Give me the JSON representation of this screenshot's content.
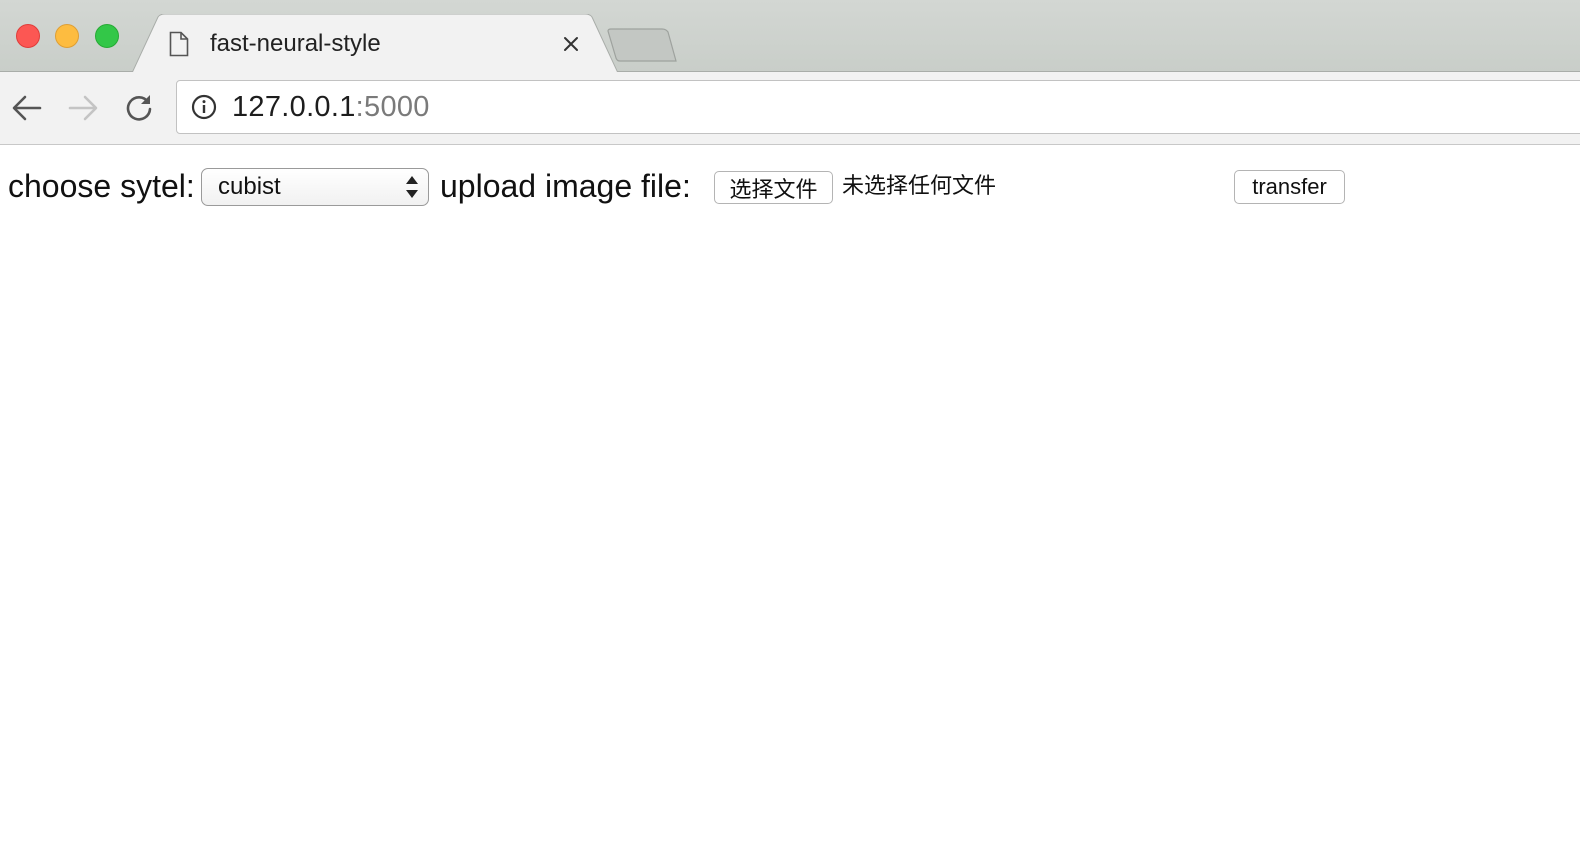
{
  "browser": {
    "window_controls": {
      "close_color": "#fc5753",
      "minimize_color": "#fdbc40",
      "maximize_color": "#33c748"
    },
    "tab": {
      "title": "fast-neural-style",
      "favicon": "document-icon",
      "close_icon": "close-icon"
    },
    "new_tab_icon": "new-tab-icon",
    "nav": {
      "back_icon": "back-arrow-icon",
      "forward_icon": "forward-arrow-icon",
      "reload_icon": "reload-icon"
    },
    "address": {
      "icon": "info-icon",
      "host": "127.0.0.1",
      "port": ":5000"
    }
  },
  "page": {
    "style_label": "choose sytel:",
    "style_select": {
      "selected": "cubist"
    },
    "upload_label": "upload image file:",
    "file_button_label": "选择文件",
    "file_status": "未选择任何文件",
    "transfer_button_label": "transfer"
  }
}
